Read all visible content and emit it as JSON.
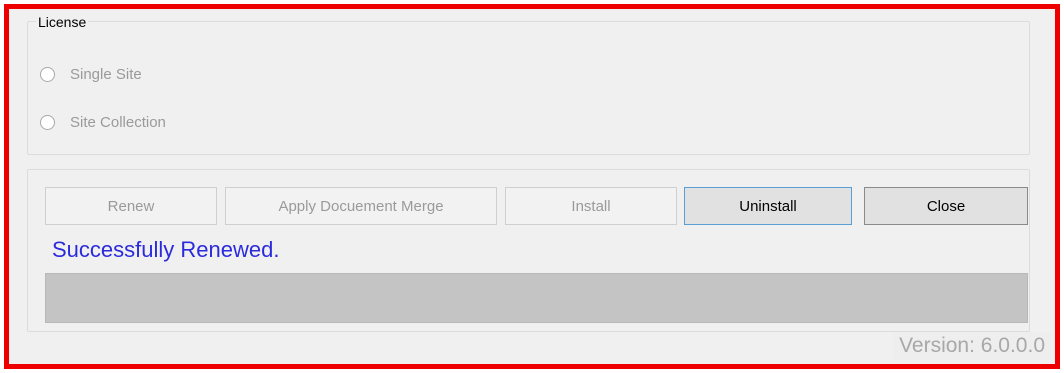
{
  "license": {
    "legend": "License",
    "options": [
      {
        "label": "Single Site",
        "selected": false
      },
      {
        "label": "Site Collection",
        "selected": false
      }
    ]
  },
  "actions": {
    "renew_label": "Renew",
    "merge_label": "Apply Docuement Merge",
    "install_label": "Install",
    "uninstall_label": "Uninstall",
    "close_label": "Close"
  },
  "status": {
    "message": "Successfully Renewed.",
    "message_color": "#2b2bdc",
    "progress_percent": 0
  },
  "footer": {
    "version": "Version: 6.0.0.0"
  },
  "colors": {
    "highlight_border": "#ee0000",
    "focus_border": "#5a9fd4"
  }
}
